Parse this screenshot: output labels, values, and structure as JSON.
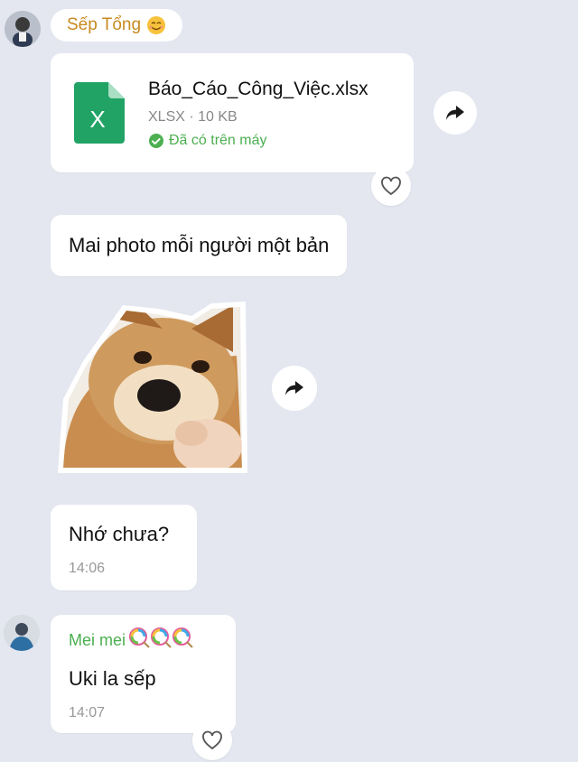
{
  "messages": {
    "boss": {
      "name": "Sếp Tổng",
      "name_emoji": "smiling-face-icon",
      "file": {
        "name": "Báo_Cáo_Công_Việc.xlsx",
        "meta": "XLSX · 10 KB",
        "status": "Đã có trên máy",
        "icon": "excel-file-icon"
      },
      "text1": "Mai photo mỗi người một bản",
      "text2": "Nhớ chưa?",
      "time2": "14:06"
    },
    "reply": {
      "name": "Mei mei",
      "name_emoji": "lollipop-icon",
      "text": "Uki la sếp",
      "time": "14:07"
    }
  },
  "colors": {
    "background": "#e4e7f0",
    "boss_name": "#c88a1f",
    "reply_name": "#4caf50",
    "excel_green": "#21a366",
    "status_green": "#4caf50"
  }
}
